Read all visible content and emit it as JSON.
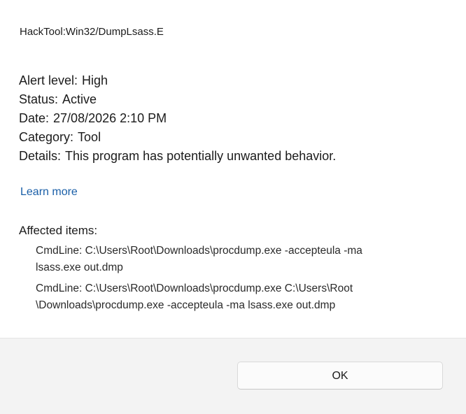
{
  "dialog": {
    "threat_name": "HackTool:Win32/DumpLsass.E",
    "details": [
      {
        "label": "Alert level:",
        "value": "High"
      },
      {
        "label": "Status:",
        "value": "Active"
      },
      {
        "label": "Date:",
        "value": "27/08/2026 2:10 PM"
      },
      {
        "label": "Category:",
        "value": "Tool"
      },
      {
        "label": "Details:",
        "value": "This program has potentially unwanted behavior."
      }
    ],
    "learn_more": "Learn more",
    "affected_label": "Affected items:",
    "affected_items": [
      {
        "line1": "CmdLine: C:\\Users\\Root\\Downloads\\procdump.exe -accepteula -ma",
        "line2": "lsass.exe out.dmp"
      },
      {
        "line1": "CmdLine: C:\\Users\\Root\\Downloads\\procdump.exe C:\\Users\\Root",
        "line2": "\\Downloads\\procdump.exe -accepteula -ma lsass.exe out.dmp"
      }
    ],
    "ok_label": "OK"
  },
  "colors": {
    "link": "#1a5fa8",
    "footer_background": "#f3f3f3",
    "text": "#1b1b1b"
  }
}
